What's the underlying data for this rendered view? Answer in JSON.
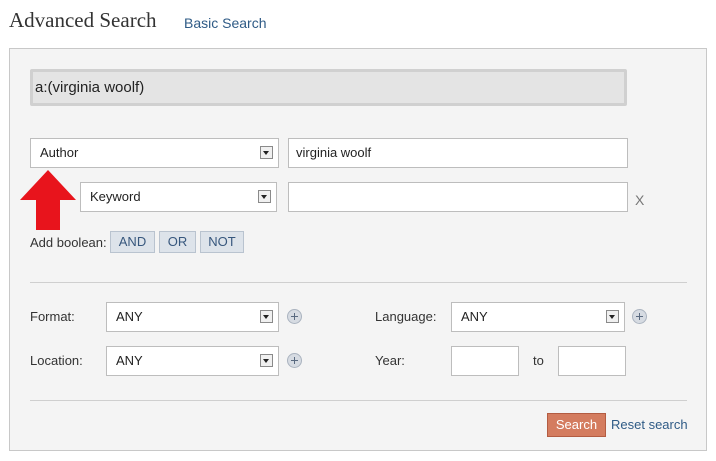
{
  "header": {
    "title": "Advanced Search",
    "basic_search_link": "Basic Search"
  },
  "query": {
    "text": "a:(virginia woolf)"
  },
  "search_rows": [
    {
      "field": "Author",
      "value": "virginia woolf"
    },
    {
      "field": "Keyword",
      "value": ""
    }
  ],
  "remove_row_label": "X",
  "boolean": {
    "label": "Add boolean:",
    "buttons": [
      "AND",
      "OR",
      "NOT"
    ]
  },
  "filters": {
    "format": {
      "label": "Format:",
      "value": "ANY"
    },
    "language": {
      "label": "Language:",
      "value": "ANY"
    },
    "location": {
      "label": "Location:",
      "value": "ANY"
    },
    "year": {
      "label": "Year:",
      "from": "",
      "to_label": "to",
      "to": ""
    }
  },
  "actions": {
    "search": "Search",
    "reset": "Reset search"
  },
  "colors": {
    "annotation_arrow": "#e8141c",
    "search_button": "#d47c5f",
    "link": "#2f5b86"
  }
}
